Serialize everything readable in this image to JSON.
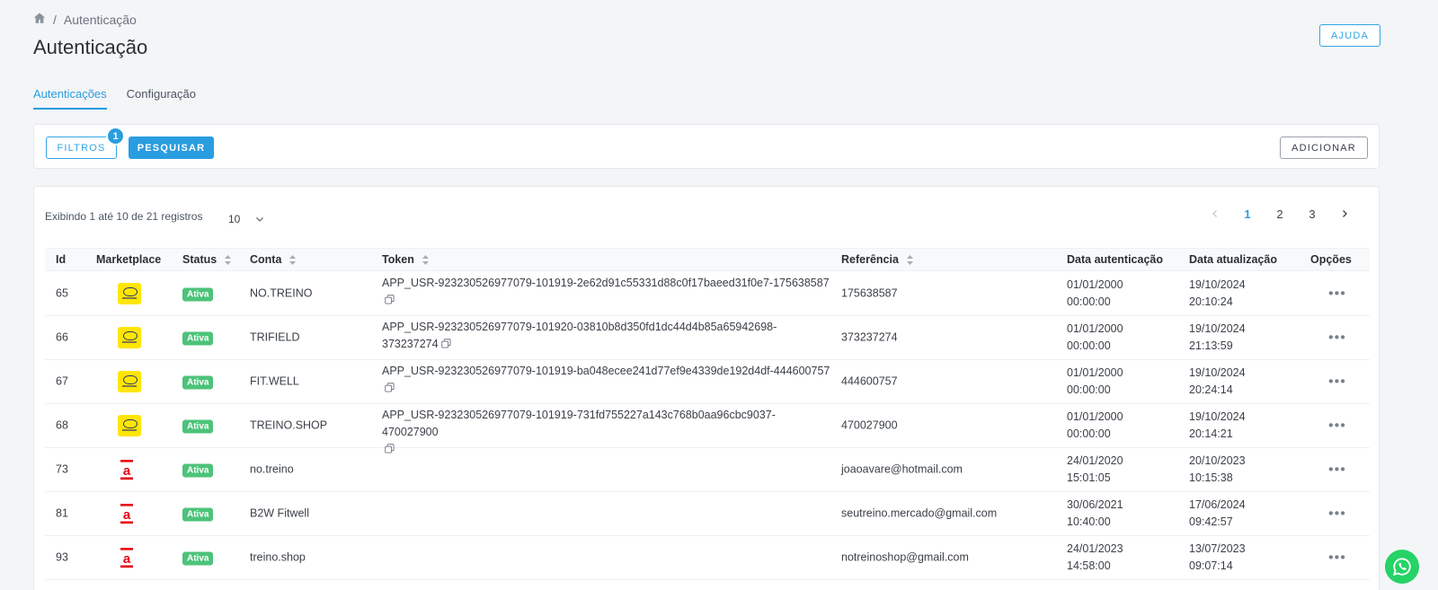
{
  "breadcrumb": {
    "separator": "/",
    "current": "Autenticação"
  },
  "page": {
    "title": "Autenticação",
    "help_label": "AJUDA"
  },
  "tabs": [
    {
      "label": "Autenticações",
      "active": true
    },
    {
      "label": "Configuração",
      "active": false
    }
  ],
  "filters": {
    "filtros_label": "FILTROS",
    "filter_count": "1",
    "pesquisar_label": "PESQUISAR",
    "adicionar_label": "ADICIONAR"
  },
  "table_info": {
    "records_text": "Exibindo 1 até 10 de 21 registros",
    "per_page": "10"
  },
  "pagination": {
    "pages": [
      "1",
      "2",
      "3"
    ],
    "current": "1"
  },
  "columns": [
    "Id",
    "Marketplace",
    "Status",
    "Conta",
    "Token",
    "Referência",
    "Data autenticação",
    "Data atualização",
    "Opções"
  ],
  "rows": [
    {
      "id": "65",
      "marketplace": "mercado-livre",
      "status": "Ativa",
      "conta": "NO.TREINO",
      "token_line1": "APP_USR-923230526977079-101919-2e62d91c55331d88c0f17baeed31f0e7-175638587",
      "token_line2": "",
      "referencia": "175638587",
      "auth_date": "01/01/2000",
      "auth_time": "00:00:00",
      "upd_date": "19/10/2024",
      "upd_time": "20:10:24"
    },
    {
      "id": "66",
      "marketplace": "mercado-livre",
      "status": "Ativa",
      "conta": "TRIFIELD",
      "token_line1": "APP_USR-923230526977079-101920-03810b8d350fd1dc44d4b85a65942698-",
      "token_line2": "373237274",
      "referencia": "373237274",
      "auth_date": "01/01/2000",
      "auth_time": "00:00:00",
      "upd_date": "19/10/2024",
      "upd_time": "21:13:59"
    },
    {
      "id": "67",
      "marketplace": "mercado-livre",
      "status": "Ativa",
      "conta": "FIT.WELL",
      "token_line1": "APP_USR-923230526977079-101919-ba048ecee241d77ef9e4339de192d4df-444600757",
      "token_line2": "",
      "referencia": "444600757",
      "auth_date": "01/01/2000",
      "auth_time": "00:00:00",
      "upd_date": "19/10/2024",
      "upd_time": "20:24:14"
    },
    {
      "id": "68",
      "marketplace": "mercado-livre",
      "status": "Ativa",
      "conta": "TREINO.SHOP",
      "token_line1": "APP_USR-923230526977079-101919-731fd755227a143c768b0aa96cbc9037-470027900",
      "token_line2": "",
      "referencia": "470027900",
      "auth_date": "01/01/2000",
      "auth_time": "00:00:00",
      "upd_date": "19/10/2024",
      "upd_time": "20:14:21"
    },
    {
      "id": "73",
      "marketplace": "americanas",
      "status": "Ativa",
      "conta": "no.treino",
      "token_line1": "",
      "token_line2": "",
      "referencia": "joaoavare@hotmail.com",
      "auth_date": "24/01/2020",
      "auth_time": "15:01:05",
      "upd_date": "20/10/2023",
      "upd_time": "10:15:38"
    },
    {
      "id": "81",
      "marketplace": "americanas",
      "status": "Ativa",
      "conta": "B2W Fitwell",
      "token_line1": "",
      "token_line2": "",
      "referencia": "seutreino.mercado@gmail.com",
      "auth_date": "30/06/2021",
      "auth_time": "10:40:00",
      "upd_date": "17/06/2024",
      "upd_time": "09:42:57"
    },
    {
      "id": "93",
      "marketplace": "americanas",
      "status": "Ativa",
      "conta": "treino.shop",
      "token_line1": "",
      "token_line2": "",
      "referencia": "notreinoshop@gmail.com",
      "auth_date": "24/01/2023",
      "auth_time": "14:58:00",
      "upd_date": "13/07/2023",
      "upd_time": "09:07:14"
    }
  ],
  "options_glyph": "•••",
  "colors": {
    "accent": "#2a9de0",
    "status_active": "#4cc37a",
    "ml_yellow": "#ffe600",
    "americanas_red": "#e60014",
    "whatsapp": "#25d366"
  }
}
